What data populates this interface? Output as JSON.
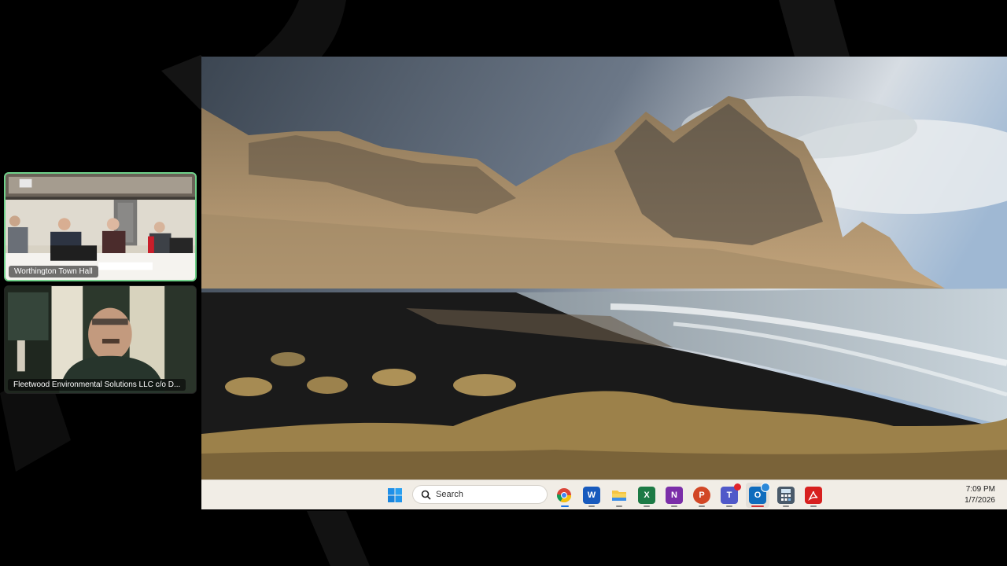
{
  "participants": [
    {
      "label": "Worthington Town Hall",
      "active_speaker": true
    },
    {
      "label": "Fleetwood Environmental Solutions LLC c/o D..."
    }
  ],
  "taskbar": {
    "search_label": "Search",
    "clock": {
      "time": "7:09 PM",
      "date": "1/7/2026"
    },
    "apps": [
      "start",
      "chrome",
      "word",
      "file-explorer",
      "excel",
      "onenote",
      "powerpoint",
      "teams",
      "outlook",
      "calculator",
      "acrobat"
    ]
  },
  "colors": {
    "active_speaker_border": "#6fd18a",
    "taskbar_bg": "#f1ede6"
  }
}
